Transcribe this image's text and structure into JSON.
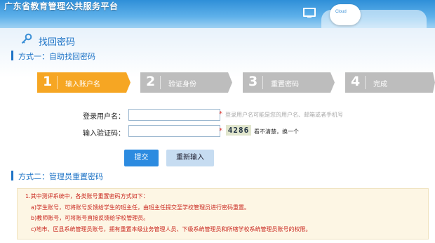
{
  "header": {
    "title": "广东省教育管理公共服务平台",
    "cloud_text": "Cloud"
  },
  "page": {
    "title": "找回密码"
  },
  "method_one": {
    "label": "方式一：自助找回密码",
    "steps": [
      {
        "num": "1",
        "label": "输入账户名",
        "state": "active"
      },
      {
        "num": "2",
        "label": "验证身份",
        "state": "inactive"
      },
      {
        "num": "3",
        "label": "重置密码",
        "state": "inactive"
      },
      {
        "num": "4",
        "label": "完成",
        "state": "inactive"
      }
    ]
  },
  "form": {
    "username_label": "登录用户名：",
    "username_value": "",
    "username_hint": "登录用户名可能是您的用户名、邮箱或者手机号",
    "captcha_label": "输入验证码：",
    "captcha_value": "",
    "captcha_code": "4286",
    "captcha_refresh": "看不清楚，换一个",
    "required_mark": "*",
    "submit_label": "提交",
    "reset_label": "重新输入"
  },
  "method_two": {
    "label": "方式二：管理员重置密码",
    "notice_lines": [
      "1.其中测评系统中，各类账号重置密码方式如下：",
      "a)学生账号，可将账号反馈给学生的班主任，由班主任提交至学校管理员进行密码重置。",
      "b)教师账号，可将账号直接反馈给学校管理员。",
      "c)地市、区县系统管理员账号，拥有重置本级业务管理人员、下级系统管理员和所辖学校系统管理员账号的权限。"
    ]
  },
  "colors": {
    "accent": "#1d73c6",
    "step_active": "#f6a623",
    "step_inactive": "#bdbdbd",
    "notice_text": "#c9251d",
    "submit_button": "#2c8be0"
  }
}
